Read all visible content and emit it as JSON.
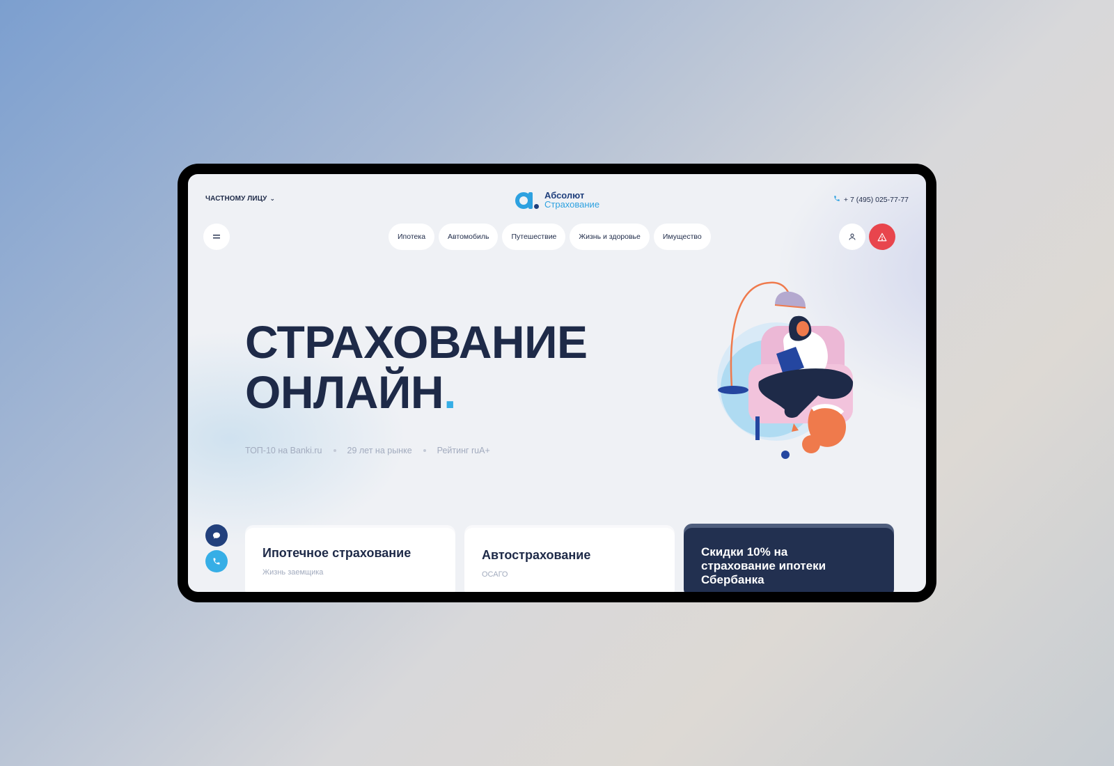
{
  "header": {
    "client_type": "ЧАСТНОМУ ЛИЦУ",
    "logo_line1": "Абсолют",
    "logo_line2": "Страхование",
    "phone": "+ 7 (495) 025-77-77"
  },
  "nav": {
    "menu_icon": "menu-icon",
    "items": [
      "Ипотека",
      "Автомобиль",
      "Путешествие",
      "Жизнь и здоровье",
      "Имущество"
    ]
  },
  "hero": {
    "title_line1": "СТРАХОВАНИЕ",
    "title_line2": "ОНЛАЙН",
    "title_dot": ".",
    "facts": [
      "ТОП-10 на Banki.ru",
      "29 лет на рынке",
      "Рейтинг ruA+"
    ]
  },
  "cards": [
    {
      "title": "Ипотечное страхование",
      "subtitle": "Жизнь заемщика"
    },
    {
      "title": "Автострахование",
      "subtitle": "ОСАГО"
    },
    {
      "title": "Скидки 10% на страхование ипотеки Сбербанка"
    }
  ],
  "colors": {
    "brand_blue": "#2da1e0",
    "brand_navy": "#1f3f7c",
    "text_dark": "#1e2a48",
    "alert_red": "#e8454d",
    "card_dark": "#223050"
  }
}
